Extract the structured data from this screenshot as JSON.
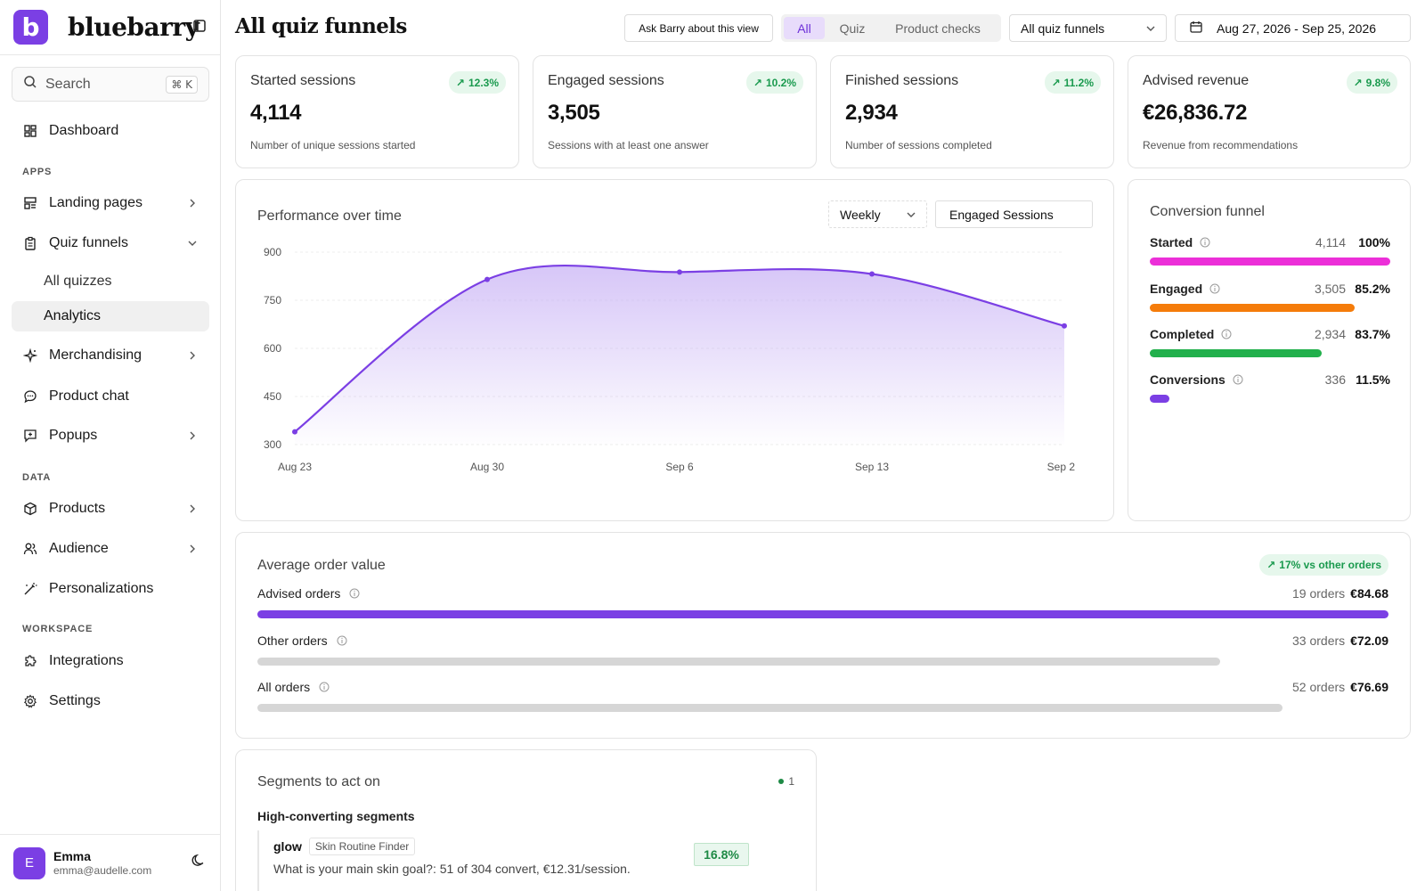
{
  "app": {
    "name": "bluebarry",
    "logo_letter": "b"
  },
  "sidebar": {
    "search": {
      "label": "Search",
      "shortcut": "⌘ K"
    },
    "dashboard": "Dashboard",
    "sections": {
      "apps": "APPS",
      "data": "DATA",
      "workspace": "WORKSPACE"
    },
    "items": {
      "landing_pages": "Landing pages",
      "quiz_funnels": "Quiz funnels",
      "all_quizzes": "All quizzes",
      "analytics": "Analytics",
      "merchandising": "Merchandising",
      "product_chat": "Product chat",
      "popups": "Popups",
      "products": "Products",
      "audience": "Audience",
      "personalizations": "Personalizations",
      "integrations": "Integrations",
      "settings": "Settings"
    },
    "user": {
      "initial": "E",
      "name": "Emma",
      "email": "emma@audelle.com"
    }
  },
  "header": {
    "title": "All quiz funnels",
    "ask_button": "Ask Barry about this view",
    "filters": [
      "All",
      "Quiz",
      "Product checks"
    ],
    "active_filter": "All",
    "funnel_select": "All quiz funnels",
    "date_range": "Aug 27, 2026 - Sep 25, 2026"
  },
  "kpis": [
    {
      "title": "Started sessions",
      "change": "12.3%",
      "value": "4,114",
      "sub": "Number of unique sessions started"
    },
    {
      "title": "Engaged sessions",
      "change": "10.2%",
      "value": "3,505",
      "sub": "Sessions with at least one answer"
    },
    {
      "title": "Finished sessions",
      "change": "11.2%",
      "value": "2,934",
      "sub": "Number of sessions completed"
    },
    {
      "title": "Advised revenue",
      "change": "9.8%",
      "value": "€26,836.72",
      "sub": "Revenue from recommendations"
    }
  ],
  "performance": {
    "title": "Performance over time",
    "interval": "Weekly",
    "metric": "Engaged Sessions"
  },
  "chart_data": {
    "type": "area",
    "x": [
      "Aug 23",
      "Aug 30",
      "Sep 6",
      "Sep 13",
      "Sep 2"
    ],
    "values": [
      340,
      815,
      838,
      832,
      670
    ],
    "yticks": [
      900,
      750,
      600,
      450,
      300
    ],
    "ylim": [
      300,
      900
    ],
    "title": "",
    "xlabel": "",
    "ylabel": "",
    "grid": true,
    "colors": {
      "line": "#7b3fe4",
      "fill": "#c9b3f5"
    }
  },
  "funnel": {
    "title": "Conversion funnel",
    "rows": [
      {
        "label": "Started",
        "count": "4,114",
        "pct": "100%",
        "fraction": 1.0,
        "color": "#ec2fd8"
      },
      {
        "label": "Engaged",
        "count": "3,505",
        "pct": "85.2%",
        "fraction": 0.852,
        "color": "#f57c0a"
      },
      {
        "label": "Completed",
        "count": "2,934",
        "pct": "83.7%",
        "fraction": 0.713,
        "color": "#22b04c"
      },
      {
        "label": "Conversions",
        "count": "336",
        "pct": "11.5%",
        "fraction": 0.082,
        "color": "#7b3fe4"
      }
    ]
  },
  "aov": {
    "title": "Average order value",
    "badge": "17% vs other orders",
    "rows": [
      {
        "label": "Advised orders",
        "orders": "19 orders",
        "value": "€84.68",
        "fraction": 1.0,
        "color": "#7b3fe4"
      },
      {
        "label": "Other orders",
        "orders": "33 orders",
        "value": "€72.09",
        "fraction": 0.851,
        "color": "#d6d6d6"
      },
      {
        "label": "All orders",
        "orders": "52 orders",
        "value": "€76.69",
        "fraction": 0.906,
        "color": "#d6d6d6"
      }
    ]
  },
  "segments": {
    "title": "Segments to act on",
    "count": "1",
    "group_title": "High-converting segments",
    "item": {
      "name": "glow",
      "tag": "Skin Routine Finder",
      "desc": "What is your main skin goal?: 51 of 304 convert, €12.31/session.",
      "rate": "16.8%"
    }
  }
}
